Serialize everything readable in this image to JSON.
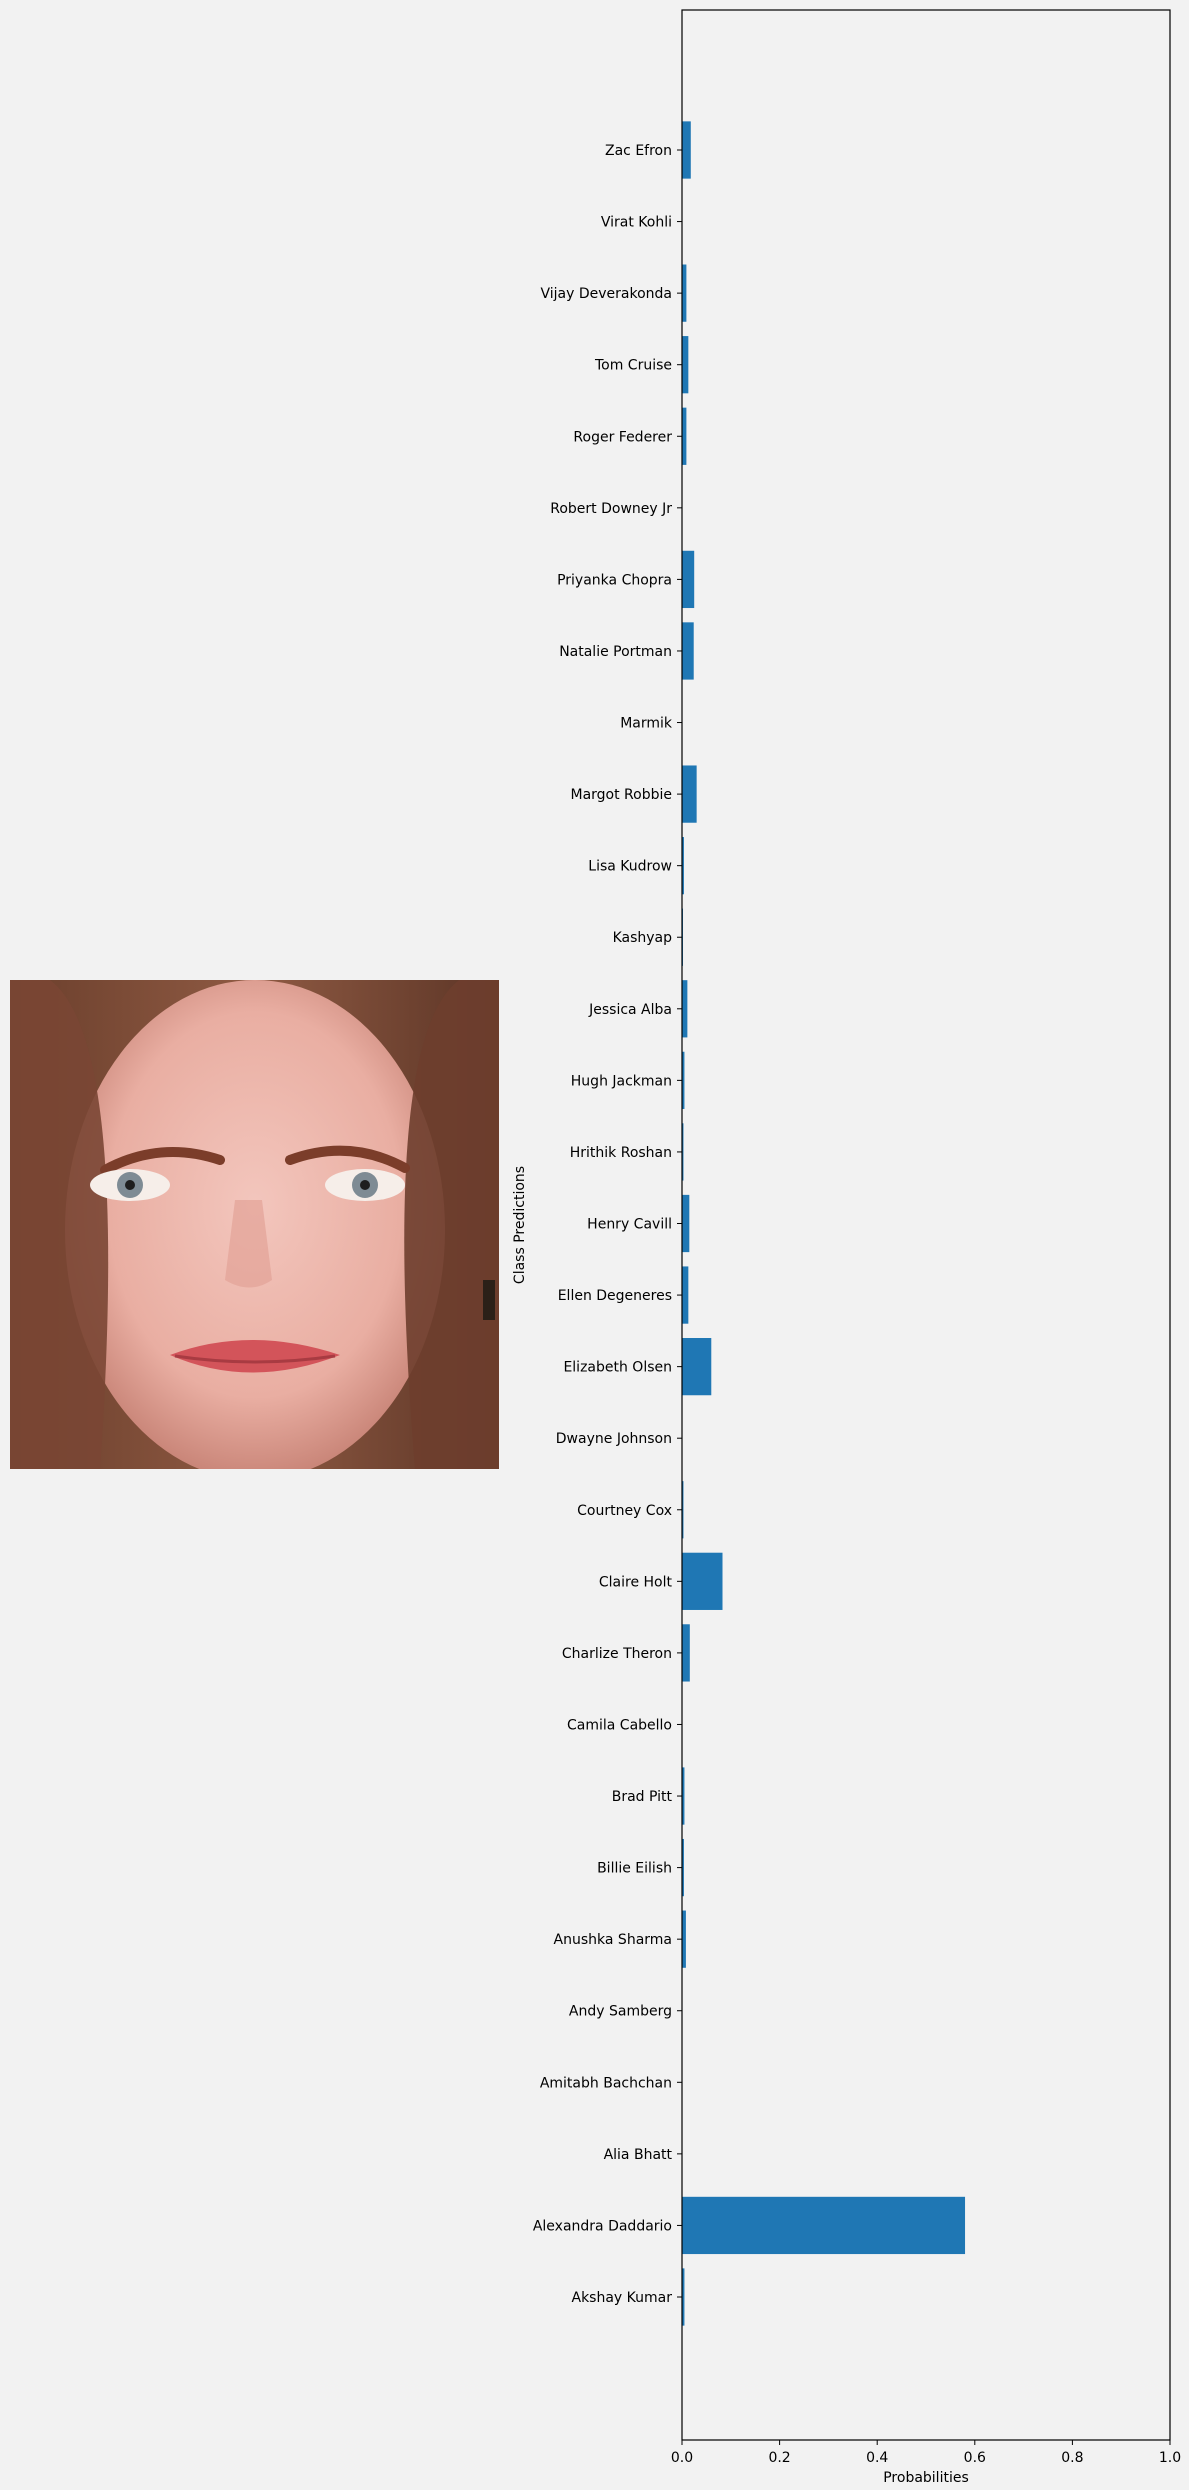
{
  "chart_data": {
    "type": "bar",
    "orientation": "horizontal",
    "categories": [
      "Akshay Kumar",
      "Alexandra Daddario",
      "Alia Bhatt",
      "Amitabh Bachchan",
      "Andy Samberg",
      "Anushka Sharma",
      "Billie Eilish",
      "Brad Pitt",
      "Camila Cabello",
      "Charlize Theron",
      "Claire Holt",
      "Courtney Cox",
      "Dwayne Johnson",
      "Elizabeth Olsen",
      "Ellen Degeneres",
      "Henry Cavill",
      "Hrithik Roshan",
      "Hugh Jackman",
      "Jessica Alba",
      "Kashyap",
      "Lisa Kudrow",
      "Margot Robbie",
      "Marmik",
      "Natalie Portman",
      "Priyanka Chopra",
      "Robert Downey Jr",
      "Roger Federer",
      "Tom Cruise",
      "Vijay Deverakonda",
      "Virat Kohli",
      "Zac Efron"
    ],
    "values": [
      0.005,
      0.58,
      0.001,
      0.001,
      0.001,
      0.008,
      0.004,
      0.005,
      0.001,
      0.016,
      0.083,
      0.003,
      0.001,
      0.06,
      0.013,
      0.015,
      0.003,
      0.005,
      0.011,
      0.002,
      0.004,
      0.03,
      0.001,
      0.024,
      0.025,
      0.001,
      0.009,
      0.013,
      0.009,
      0.001,
      0.018
    ],
    "xlabel": "Probabilities",
    "ylabel": "Class Predictions",
    "xlim": [
      0,
      1.0
    ],
    "xticks": [
      "0.0",
      "0.2",
      "0.4",
      "0.6",
      "0.8",
      "1.0"
    ],
    "bar_color": "#1f77b4",
    "grid": false
  },
  "image": {
    "description_icon": "face-photo"
  }
}
